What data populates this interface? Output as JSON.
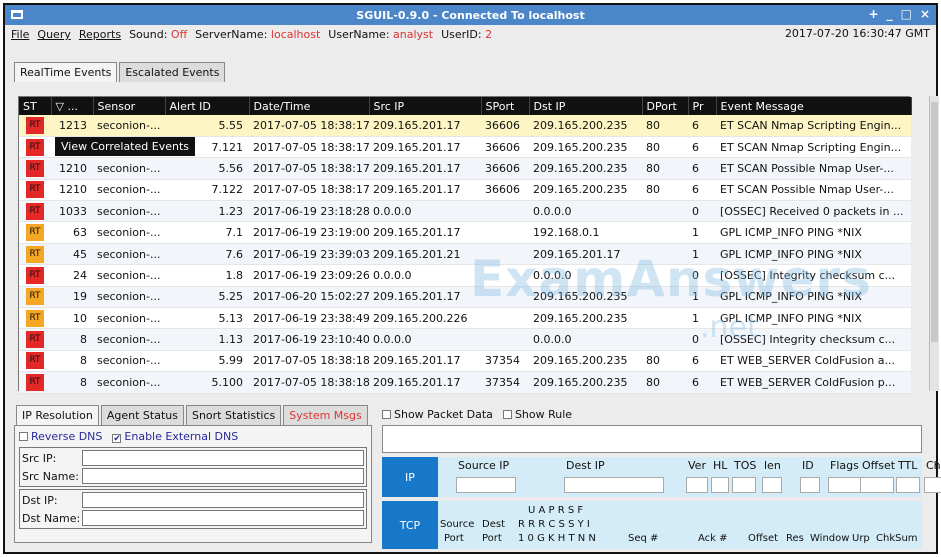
{
  "window": {
    "title": "SGUIL-0.9.0 - Connected To localhost",
    "controls": [
      "+",
      "_",
      "□",
      "×"
    ]
  },
  "menu": {
    "items": [
      "File",
      "Query",
      "Reports"
    ],
    "sound_label": "Sound:",
    "sound_value": "Off",
    "server_label": "ServerName:",
    "server_value": "localhost",
    "user_label": "UserName:",
    "user_value": "analyst",
    "userid_label": "UserID:",
    "userid_value": "2",
    "datetime": "2017-07-20 16:30:47 GMT"
  },
  "top_tabs": [
    "RealTime Events",
    "Escalated Events"
  ],
  "grid": {
    "columns": [
      "ST",
      "▽ ...",
      "Sensor",
      "Alert ID",
      "Date/Time",
      "Src IP",
      "SPort",
      "Dst IP",
      "DPort",
      "Pr",
      "Event Message"
    ],
    "rows": [
      {
        "st": "RT",
        "color": "#e42828",
        "cnt": "1213",
        "sensor": "seconion-...",
        "alert": "5.55",
        "dt": "2017-07-05 18:38:17",
        "src": "209.165.201.17",
        "sport": "36606",
        "dst": "209.165.200.235",
        "dport": "80",
        "pr": "6",
        "msg": "ET SCAN Nmap Scripting Engin..."
      },
      {
        "st": "RT",
        "color": "#e42828",
        "cnt": "",
        "sensor": "",
        "alert": "7.121",
        "dt": "2017-07-05 18:38:17",
        "src": "209.165.201.17",
        "sport": "36606",
        "dst": "209.165.200.235",
        "dport": "80",
        "pr": "6",
        "msg": "ET SCAN Nmap Scripting Engin..."
      },
      {
        "st": "RT",
        "color": "#e42828",
        "cnt": "1210",
        "sensor": "seconion-...",
        "alert": "5.56",
        "dt": "2017-07-05 18:38:17",
        "src": "209.165.201.17",
        "sport": "36606",
        "dst": "209.165.200.235",
        "dport": "80",
        "pr": "6",
        "msg": "ET SCAN Possible Nmap User-..."
      },
      {
        "st": "RT",
        "color": "#e42828",
        "cnt": "1210",
        "sensor": "seconion-...",
        "alert": "7.122",
        "dt": "2017-07-05 18:38:17",
        "src": "209.165.201.17",
        "sport": "36606",
        "dst": "209.165.200.235",
        "dport": "80",
        "pr": "6",
        "msg": "ET SCAN Possible Nmap User-..."
      },
      {
        "st": "RT",
        "color": "#e42828",
        "cnt": "1033",
        "sensor": "seconion-...",
        "alert": "1.23",
        "dt": "2017-06-19 23:18:28",
        "src": "0.0.0.0",
        "sport": "",
        "dst": "0.0.0.0",
        "dport": "",
        "pr": "0",
        "msg": "[OSSEC] Received 0 packets in ..."
      },
      {
        "st": "RT",
        "color": "#f5a623",
        "cnt": "63",
        "sensor": "seconion-...",
        "alert": "7.1",
        "dt": "2017-06-19 23:19:00",
        "src": "209.165.201.17",
        "sport": "",
        "dst": "192.168.0.1",
        "dport": "",
        "pr": "1",
        "msg": "GPL ICMP_INFO PING *NIX"
      },
      {
        "st": "RT",
        "color": "#f5a623",
        "cnt": "45",
        "sensor": "seconion-...",
        "alert": "7.6",
        "dt": "2017-06-19 23:39:03",
        "src": "209.165.201.21",
        "sport": "",
        "dst": "209.165.201.17",
        "dport": "",
        "pr": "1",
        "msg": "GPL ICMP_INFO PING *NIX"
      },
      {
        "st": "RT",
        "color": "#e42828",
        "cnt": "24",
        "sensor": "seconion-...",
        "alert": "1.8",
        "dt": "2017-06-19 23:09:26",
        "src": "0.0.0.0",
        "sport": "",
        "dst": "0.0.0.0",
        "dport": "",
        "pr": "0",
        "msg": "[OSSEC] Integrity checksum c..."
      },
      {
        "st": "RT",
        "color": "#f5a623",
        "cnt": "19",
        "sensor": "seconion-...",
        "alert": "5.25",
        "dt": "2017-06-20 15:02:27",
        "src": "209.165.201.17",
        "sport": "",
        "dst": "209.165.200.235",
        "dport": "",
        "pr": "1",
        "msg": "GPL ICMP_INFO PING *NIX"
      },
      {
        "st": "RT",
        "color": "#f5a623",
        "cnt": "10",
        "sensor": "seconion-...",
        "alert": "5.13",
        "dt": "2017-06-19 23:38:49",
        "src": "209.165.200.226",
        "sport": "",
        "dst": "209.165.200.235",
        "dport": "",
        "pr": "1",
        "msg": "GPL ICMP_INFO PING *NIX"
      },
      {
        "st": "RT",
        "color": "#e42828",
        "cnt": "8",
        "sensor": "seconion-...",
        "alert": "1.13",
        "dt": "2017-06-19 23:10:40",
        "src": "0.0.0.0",
        "sport": "",
        "dst": "0.0.0.0",
        "dport": "",
        "pr": "0",
        "msg": "[OSSEC] Integrity checksum c..."
      },
      {
        "st": "RT",
        "color": "#e42828",
        "cnt": "8",
        "sensor": "seconion-...",
        "alert": "5.99",
        "dt": "2017-07-05 18:38:18",
        "src": "209.165.201.17",
        "sport": "37354",
        "dst": "209.165.200.235",
        "dport": "80",
        "pr": "6",
        "msg": "ET WEB_SERVER ColdFusion a..."
      },
      {
        "st": "RT",
        "color": "#e42828",
        "cnt": "8",
        "sensor": "seconion-...",
        "alert": "5.100",
        "dt": "2017-07-05 18:38:18",
        "src": "209.165.201.17",
        "sport": "37354",
        "dst": "209.165.200.235",
        "dport": "80",
        "pr": "6",
        "msg": "ET WEB_SERVER ColdFusion p..."
      }
    ]
  },
  "tooltip": "View Correlated Events",
  "watermark": "ExamAnswers",
  "watermark2": ".net",
  "lower_tabs": [
    {
      "label": "IP Resolution",
      "active": true,
      "red": false
    },
    {
      "label": "Agent Status",
      "active": false,
      "red": false
    },
    {
      "label": "Snort Statistics",
      "active": false,
      "red": false
    },
    {
      "label": "System Msgs",
      "active": false,
      "red": true
    }
  ],
  "ip_resolution": {
    "reverse_dns": "Reverse DNS",
    "external_dns": "Enable External DNS",
    "external_dns_mark": "✔",
    "src_ip": "Src IP:",
    "src_name": "Src Name:",
    "dst_ip": "Dst IP:",
    "dst_name": "Dst Name:"
  },
  "packet": {
    "show_packet": "Show Packet Data",
    "show_rule": "Show Rule",
    "ip_label": "IP",
    "ip_cols": [
      "Source IP",
      "Dest IP",
      "Ver",
      "HL",
      "TOS",
      "len",
      "ID",
      "Flags",
      "Offset",
      "TTL",
      "ChkSum"
    ],
    "tcp_label": "TCP",
    "tcp_src": "Source",
    "tcp_port": "Port",
    "tcp_dest": "Dest",
    "tcp_flags_top": "U A P R S F",
    "tcp_flags_mid": "R R R C S S Y I",
    "tcp_flags_bot": "1 0 G K H T N N",
    "tcp_cols": [
      "Seq #",
      "Ack #",
      "Offset",
      "Res",
      "Window",
      "Urp",
      "ChkSum"
    ]
  }
}
